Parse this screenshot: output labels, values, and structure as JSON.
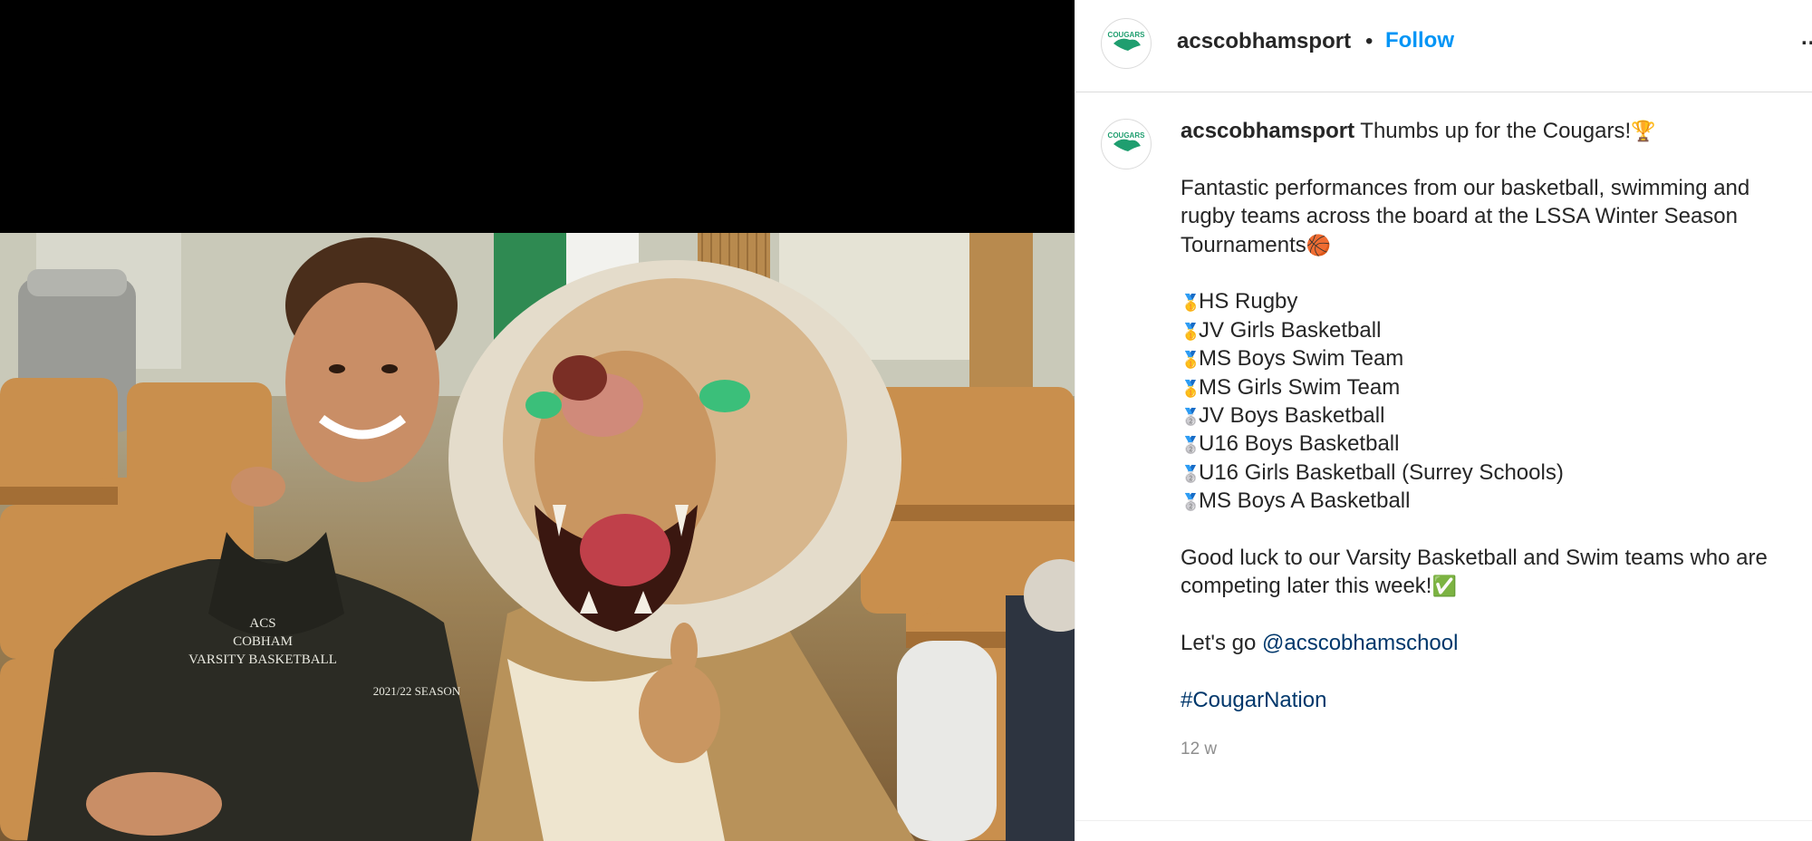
{
  "post": {
    "username": "acscobhamsport",
    "separator": "•",
    "follow_label": "Follow",
    "more_icon": "…",
    "avatar_text": "COUGARS"
  },
  "caption": {
    "username": "acscobhamsport",
    "headline": "Thumbs up for the Cougars!",
    "headline_emoji": "🏆",
    "paragraph1": "Fantastic performances from our basketball, swimming and rugby teams across the board at the LSSA Winter Season Tournaments",
    "paragraph1_emoji": "🏀",
    "results": [
      {
        "medal": "🥇",
        "team": "HS Rugby"
      },
      {
        "medal": "🥇",
        "team": "JV Girls Basketball"
      },
      {
        "medal": "🥇",
        "team": "MS Boys Swim Team"
      },
      {
        "medal": "🥇",
        "team": "MS Girls Swim Team"
      },
      {
        "medal": "🥈",
        "team": "JV Boys Basketball"
      },
      {
        "medal": "🥈",
        "team": "U16 Boys Basketball"
      },
      {
        "medal": "🥈",
        "team": "U16 Girls Basketball (Surrey Schools)"
      },
      {
        "medal": "🥈",
        "team": "MS Boys A Basketball"
      }
    ],
    "paragraph2": "Good luck to our Varsity Basketball and Swim teams who are competing later this week!",
    "paragraph2_emoji": "✅",
    "letsgo_prefix": "Let's go ",
    "mention": "@acscobhamschool",
    "hashtag": "#CougarNation"
  },
  "timestamp": "12 w",
  "photo": {
    "hoodie_text_line1": "ACS",
    "hoodie_text_line2": "COBHAM",
    "hoodie_text_line3": "VARSITY BASKETBALL",
    "hoodie_season": "2021/22 SEASON"
  },
  "colors": {
    "follow": "#0095f6",
    "link": "#00376b",
    "avatar_green": "#1f9e6f"
  }
}
